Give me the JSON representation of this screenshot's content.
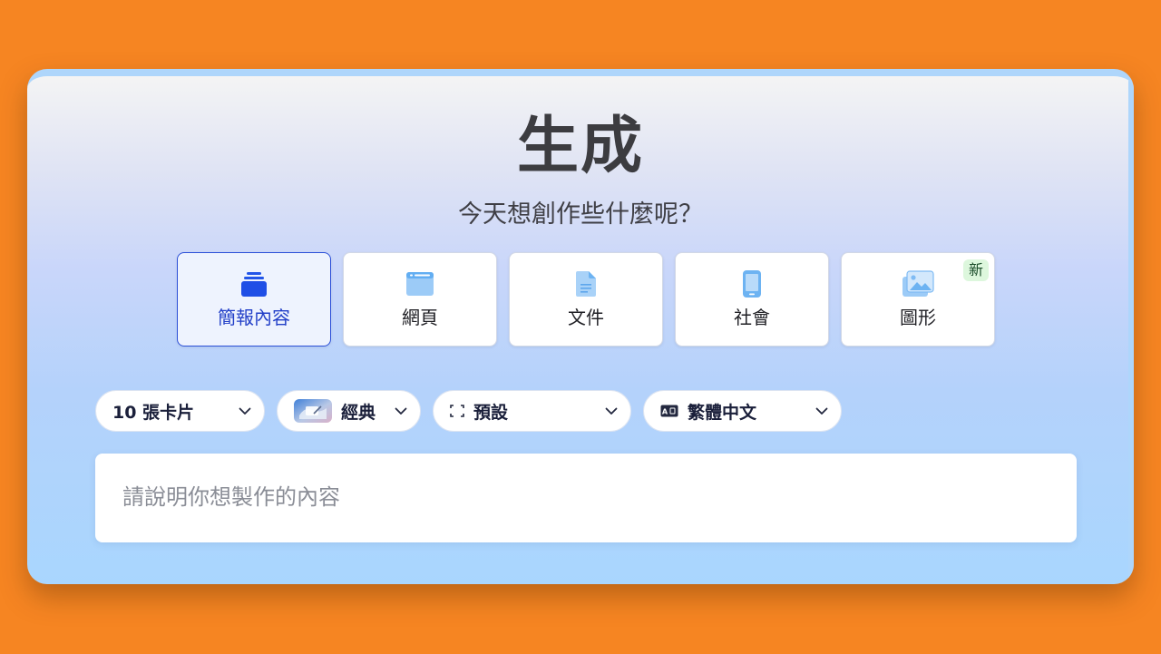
{
  "header": {
    "title": "生成",
    "subtitle": "今天想創作些什麼呢？"
  },
  "modes": [
    {
      "label": "簡報內容",
      "icon": "presentation-stack-icon",
      "active": true
    },
    {
      "label": "網頁",
      "icon": "webpage-icon",
      "active": false
    },
    {
      "label": "文件",
      "icon": "document-icon",
      "active": false
    },
    {
      "label": "社會",
      "icon": "phone-icon",
      "active": false
    },
    {
      "label": "圖形",
      "icon": "image-icon",
      "active": false,
      "badge": "新"
    }
  ],
  "options": {
    "cards": {
      "label": "10 張卡片",
      "icon": "chevron-down-icon"
    },
    "theme": {
      "label": "經典",
      "icon": "theme-thumbnail-icon"
    },
    "size": {
      "label": "預設",
      "icon": "frame-corners-icon"
    },
    "language": {
      "label": "繁體中文",
      "icon": "language-icon"
    }
  },
  "prompt": {
    "placeholder": "請說明你想製作的內容"
  },
  "colors": {
    "background": "#F68522",
    "accent": "#2B4FD8",
    "badge_bg": "#DDF7DD"
  }
}
